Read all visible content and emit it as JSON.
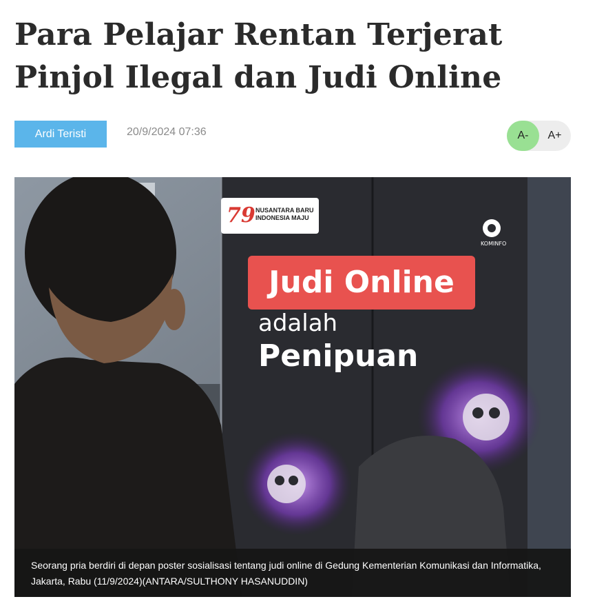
{
  "article": {
    "title": "Para Pelajar Rentan Terjerat Pinjol Ilegal dan Judi Online",
    "author": "Ardi Teristi",
    "date": "20/9/2024 07:36"
  },
  "font_controls": {
    "decrease_label": "A-",
    "increase_label": "A+"
  },
  "photo": {
    "poster_headline": "Judi Online",
    "poster_line2": "adalah",
    "poster_line3": "Penipuan",
    "logo_number": "79",
    "logo_text": "NUSANTARA BARU INDONESIA MAJU",
    "kominfo_label": "KOMINFO",
    "caption": "Seorang pria berdiri di depan poster sosialisasi tentang judi online di Gedung Kementerian Komunikasi dan Informatika, Jakarta, Rabu (11/9/2024)(ANTARA/SULTHONY HASANUDDIN)"
  },
  "colors": {
    "author_badge": "#5bb5ea",
    "font_minus_active": "#99e093",
    "font_controls_bg": "#ededed",
    "poster_banner": "#e8524f",
    "caption_bg": "#161616"
  }
}
